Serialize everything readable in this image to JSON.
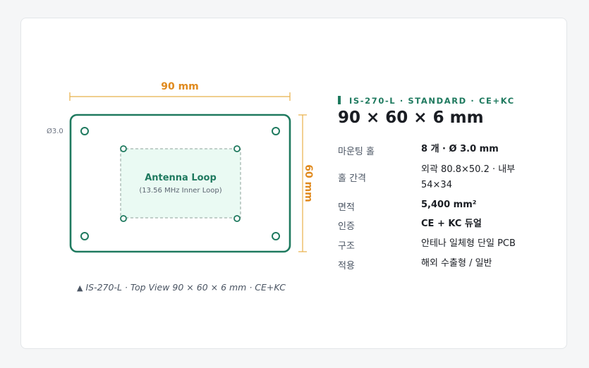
{
  "diagram": {
    "width_label": "90 mm",
    "height_label": "60 mm",
    "hole_label": "Ø3.0",
    "loop_title": "Antenna Loop",
    "loop_subtitle": "(13.56 MHz Inner Loop)",
    "caption_icon": "triangle-icon",
    "caption": "IS-270-L · Top View 90 × 60 × 6 mm · CE+KC",
    "colors": {
      "board": "#1f7a5f",
      "loop_fill": "#eafaf3",
      "loop_stroke": "#8fa39b",
      "dimension": "#e08a1e"
    }
  },
  "spec": {
    "model_line": "IS-270-L · STANDARD · CE+KC",
    "size_title": "90 × 60 × 6 mm",
    "rows": [
      {
        "label": "마운팅 홀",
        "value": "8 개 · Ø 3.0 mm"
      },
      {
        "label": "홀 간격",
        "value": "외곽 80.8×50.2 · 내부 54×34"
      },
      {
        "label": "면적",
        "value": "5,400 mm²"
      },
      {
        "label": "인증",
        "value": "CE + KC 듀얼"
      },
      {
        "label": "구조",
        "value": "안테나 일체형 단일 PCB"
      },
      {
        "label": "적용",
        "value": "해외 수출형 / 일반"
      }
    ]
  }
}
